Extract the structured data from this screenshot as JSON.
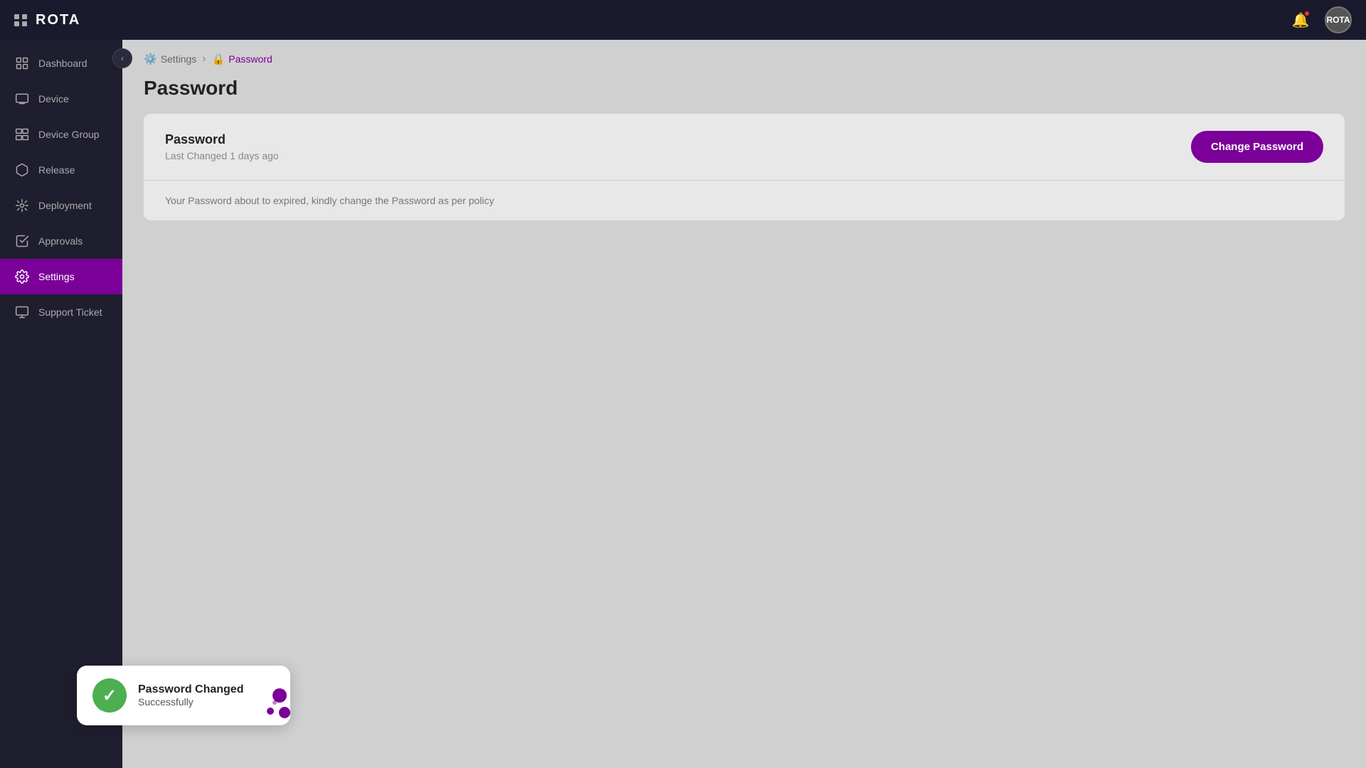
{
  "app": {
    "name": "ROTA"
  },
  "topbar": {
    "logo": "ROTA",
    "avatar_text": "ROTA"
  },
  "sidebar": {
    "items": [
      {
        "id": "dashboard",
        "label": "Dashboard",
        "icon": "dashboard"
      },
      {
        "id": "device",
        "label": "Device",
        "icon": "device"
      },
      {
        "id": "device-group",
        "label": "Device Group",
        "icon": "device-group"
      },
      {
        "id": "release",
        "label": "Release",
        "icon": "release"
      },
      {
        "id": "deployment",
        "label": "Deployment",
        "icon": "deployment"
      },
      {
        "id": "approvals",
        "label": "Approvals",
        "icon": "approvals"
      },
      {
        "id": "settings",
        "label": "Settings",
        "icon": "settings",
        "active": true
      },
      {
        "id": "support-ticket",
        "label": "Support Ticket",
        "icon": "support"
      }
    ]
  },
  "breadcrumb": {
    "parent": "Settings",
    "current": "Password"
  },
  "page": {
    "title": "Password"
  },
  "password_card": {
    "title": "Password",
    "subtitle": "Last Changed 1 days ago",
    "button_label": "Change Password",
    "expiry_notice": "Your Password about to expired, kindly change the Password as per policy"
  },
  "toast": {
    "title": "Password Changed",
    "subtitle": "Successfully"
  }
}
